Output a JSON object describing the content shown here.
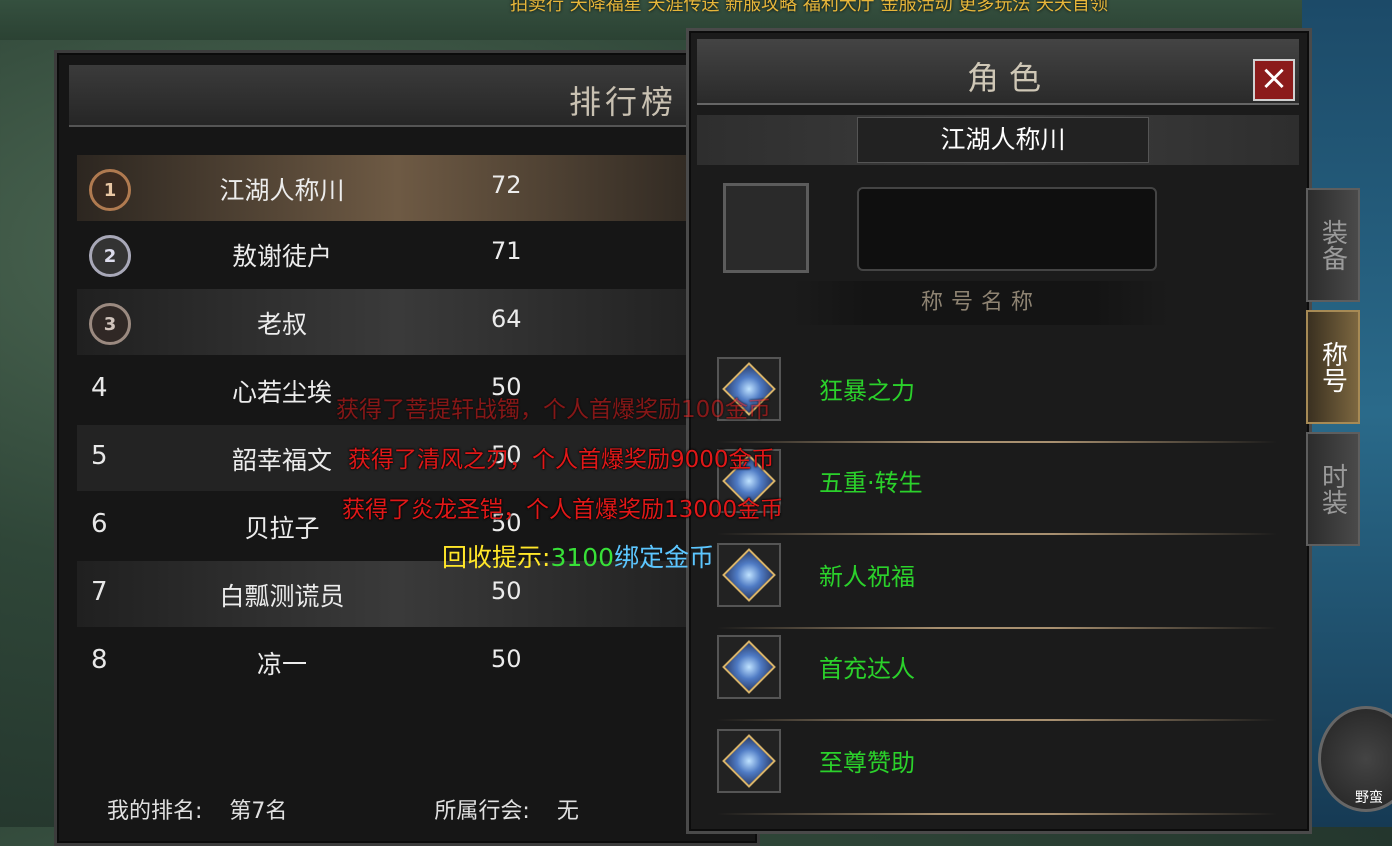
{
  "top_menu_text": "拍卖行  天降福星  天涯传送  新服攻略  福利大厅  金服活动  更多玩法  天天首领",
  "ranking": {
    "title": "排行榜",
    "rows": [
      {
        "rank": "1",
        "name": "江湖人称川",
        "level": "72"
      },
      {
        "rank": "2",
        "name": "敖谢徒户",
        "level": "71"
      },
      {
        "rank": "3",
        "name": "老叔",
        "level": "64"
      },
      {
        "rank": "4",
        "name": "心若尘埃",
        "level": "50"
      },
      {
        "rank": "5",
        "name": "韶幸福文",
        "level": "50"
      },
      {
        "rank": "6",
        "name": "贝拉子",
        "level": "50"
      },
      {
        "rank": "7",
        "name": "白瓢测谎员",
        "level": "50"
      },
      {
        "rank": "8",
        "name": "凉一",
        "level": "50"
      }
    ],
    "my_rank_label": "我的排名:",
    "my_rank_value": "第7名",
    "guild_label": "所属行会:",
    "guild_value": "无"
  },
  "character": {
    "title": "角色",
    "close_icon": "×",
    "player_name": "江湖人称川",
    "title_name_header": "称号名称",
    "titles": [
      "狂暴之力",
      "五重·转生",
      "新人祝福",
      "首充达人",
      "至尊赞助"
    ]
  },
  "side_tabs": [
    "装备",
    "称号",
    "时装"
  ],
  "notices": {
    "line1": "获得了菩提轩战镯，个人首爆奖励100金币",
    "line2": "获得了清风之刃，个人首爆奖励9000金币",
    "line3": "获得了炎龙圣铠，个人首爆奖励13000金币",
    "recycle_label": "回收提示:",
    "recycle_amount": "3100",
    "recycle_unit": "绑定金币"
  },
  "wild_icon_label": "野蛮",
  "colors": {
    "title_green": "#2bd12b",
    "notice_red": "#e01818",
    "recycle_yellow": "#ffe629",
    "recycle_green": "#38e038",
    "recycle_blue": "#5cc6ff"
  }
}
